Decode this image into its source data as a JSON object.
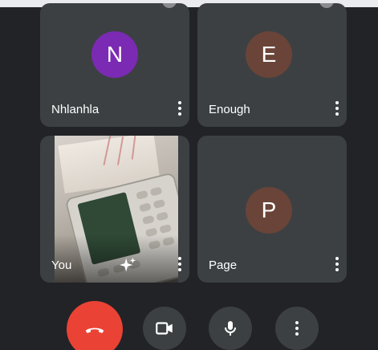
{
  "participants": [
    {
      "name": "Nhlanhla",
      "initial": "N",
      "avatar_color": "#7b2ab3"
    },
    {
      "name": "Enough",
      "initial": "E",
      "avatar_color": "#6a4438"
    },
    {
      "name": "You",
      "initial": "",
      "avatar_color": ""
    },
    {
      "name": "Page",
      "initial": "P",
      "avatar_color": "#6a4438"
    }
  ],
  "icons": {
    "tile_menu": "more-vert-icon",
    "self_effects": "sparkle-icon",
    "end_call": "phone-hangup-icon",
    "camera": "videocam-icon",
    "microphone": "mic-icon",
    "more": "more-vert-icon"
  },
  "colors": {
    "background": "#222326",
    "tile": "#3c4043",
    "end_call": "#ea4335"
  }
}
